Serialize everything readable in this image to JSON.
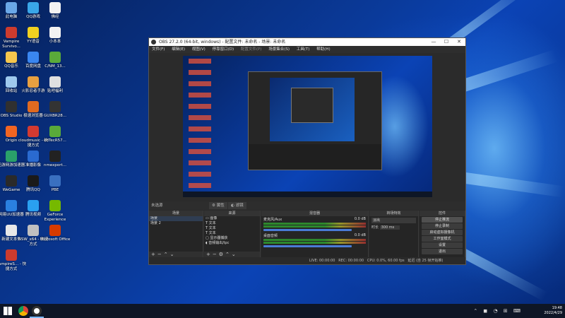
{
  "desktop": {
    "icons": [
      {
        "label": "此电脑",
        "icon": "computer-icon",
        "color": "#6aa8e8"
      },
      {
        "label": "QQ游戏",
        "icon": "qq-game-icon",
        "color": "#3aa7e8"
      },
      {
        "label": "佛经",
        "icon": "document-icon",
        "color": "#f2f2f2"
      },
      {
        "label": "Vampire Survivo...",
        "icon": "red-app-icon",
        "color": "#cc3b2e"
      },
      {
        "label": "YY语音",
        "icon": "yy-icon",
        "color": "#f0d020"
      },
      {
        "label": "小本本",
        "icon": "document-icon",
        "color": "#f2f2f2"
      },
      {
        "label": "QQ音乐",
        "icon": "qq-music-icon",
        "color": "#f6c64d"
      },
      {
        "label": "百度网盘",
        "icon": "baidu-pan-icon",
        "color": "#3a86f0"
      },
      {
        "label": "C/NM_13...",
        "icon": "battery-file-icon",
        "color": "#5aaa3a"
      },
      {
        "label": "回收站",
        "icon": "recycle-bin-icon",
        "color": "#9ec9ee"
      },
      {
        "label": "火影忍者手游",
        "icon": "game-icon",
        "color": "#e8a040"
      },
      {
        "label": "贴吧福利",
        "icon": "document-icon",
        "color": "#e0e0e0"
      },
      {
        "label": "OBS Studio",
        "icon": "obs-icon",
        "color": "#303030"
      },
      {
        "label": "极速浏览器",
        "icon": "browser-icon",
        "color": "#e06a20"
      },
      {
        "label": "GUXBR28...",
        "icon": "video-file-icon",
        "color": "#333333"
      },
      {
        "label": "Origin",
        "icon": "origin-icon",
        "color": "#f26522"
      },
      {
        "label": "cloudmusic - 快捷方式",
        "icon": "netease-music-icon",
        "color": "#d33a31"
      },
      {
        "label": "edTecR57...",
        "icon": "battery-file-icon",
        "color": "#5aaa3a"
      },
      {
        "label": "迅游网游加速器",
        "icon": "xunyou-icon",
        "color": "#2aa06a"
      },
      {
        "label": "准播影像",
        "icon": "camera-icon",
        "color": "#2a6ad0"
      },
      {
        "label": "nmexport...",
        "icon": "video-file-icon",
        "color": "#222222"
      },
      {
        "label": "WeGame",
        "icon": "wegame-icon",
        "color": "#2a2a2a"
      },
      {
        "label": "腾讯QQ",
        "icon": "qq-icon",
        "color": "#1a1a1a"
      },
      {
        "label": "PBE",
        "icon": "document-icon",
        "color": "#3a70c0"
      },
      {
        "label": "网易UU加速器",
        "icon": "uu-icon",
        "color": "#2a80e0"
      },
      {
        "label": "腾讯视频",
        "icon": "tencent-video-icon",
        "color": "#2aa0f0"
      },
      {
        "label": "GeForce Experience",
        "icon": "geforce-icon",
        "color": "#76b900"
      },
      {
        "label": "新建文本件",
        "icon": "text-file-icon",
        "color": "#e8e8e8"
      },
      {
        "label": "NSW_x64 - 快捷方式",
        "icon": "app-icon",
        "color": "#c0c0c0"
      },
      {
        "label": "Microsoft Office",
        "icon": "office-icon",
        "color": "#d83b01"
      },
      {
        "label": "VampireS... - 快捷方式",
        "icon": "red-app-icon",
        "color": "#cc3b2e"
      }
    ]
  },
  "obs": {
    "title": "OBS 27.2.0 (64-bit, windows) - 配置文件: 未命名 - 场景: 未命名",
    "menu": [
      "文件(F)",
      "编辑(E)",
      "视图(V)",
      "停靠窗口(D)",
      "配置文件(P)",
      "场景集合(S)",
      "工具(T)",
      "帮助(H)"
    ],
    "canvas_label": "未选源",
    "canvas_buttons": [
      "属性",
      "滤镜"
    ],
    "scenes": {
      "header": "场景",
      "items": [
        "场景",
        "场景 2"
      ]
    },
    "sources": {
      "header": "来源",
      "items": [
        "图像",
        "文本",
        "文本",
        "文本",
        "显示器捕获",
        "音频输出/Ipc"
      ]
    },
    "mixer": {
      "header": "混音器",
      "tracks": [
        {
          "name": "麦克风/Aux",
          "db": "0.0 dB"
        },
        {
          "name": "桌面音频",
          "db": "0.0 dB"
        }
      ]
    },
    "transitions": {
      "header": "转场特效",
      "type": "淡出",
      "duration_label": "时长",
      "duration": "300 ms"
    },
    "controls": {
      "header": "控件",
      "buttons": [
        "停止推流",
        "停止录制",
        "启动虚拟摄像机",
        "工作室模式",
        "设置",
        "退出"
      ]
    },
    "status": "LIVE: 00:00:00   REC: 00:00:00   CPU: 0.0%, 60.00 fps   延迟 (自 25 帧开始推) "
  },
  "taskbar": {
    "time": "19:48",
    "date": "2022/4/29",
    "icons": [
      "start-icon",
      "chrome-icon",
      "obs-icon"
    ]
  }
}
